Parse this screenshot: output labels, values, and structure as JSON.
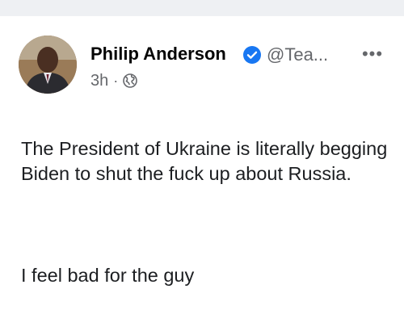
{
  "post": {
    "author_name": "Philip Anderson",
    "handle": "@Tea...",
    "time": "3h",
    "separator": "·",
    "audience_icon": "globe-icon",
    "verified_icon": "verified-badge-icon",
    "more_label": "•••",
    "text_paragraph_1": "The President of Ukraine is literally begging Biden to shut the fuck up about Russia.",
    "text_paragraph_2": "I feel bad for the guy"
  },
  "colors": {
    "verified": "#1877f2",
    "meta": "#65676b",
    "background_strip": "#eef0f3"
  }
}
